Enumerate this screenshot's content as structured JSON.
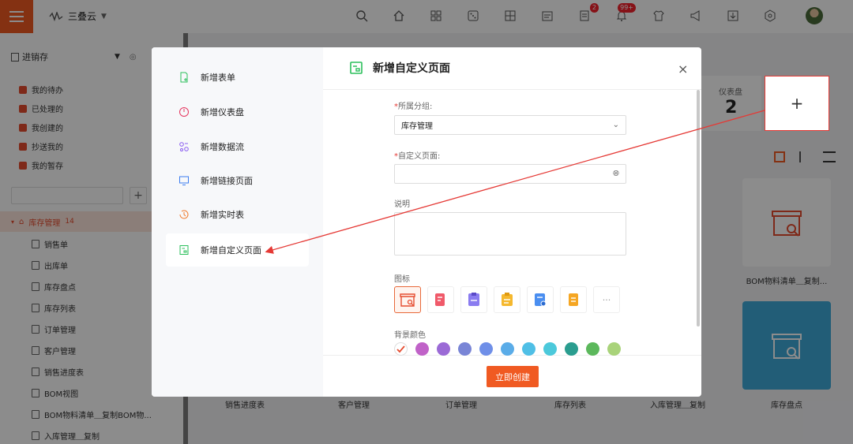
{
  "app": {
    "brand": "三叠云",
    "notifications_badge": "2",
    "messages_badge": "99+"
  },
  "sidebar": {
    "title": "进销存",
    "quick_items": [
      "我的待办",
      "已处理的",
      "我创建的",
      "抄送我的",
      "我的暂存"
    ],
    "group": {
      "label": "库存管理",
      "count": "14"
    },
    "sub_items": [
      "销售单",
      "出库单",
      "库存盘点",
      "库存列表",
      "订单管理",
      "客户管理",
      "销售进度表",
      "BOM视图",
      "BOM物料清单＿复制BOM物...",
      "入库管理＿复制"
    ]
  },
  "main": {
    "stat_label": "仪表盘",
    "stat_value": "2",
    "add_symbol": "+",
    "tile_labels_top": [
      "BOM物料清单＿复制..."
    ],
    "tile_labels_bottom": [
      "销售进度表",
      "客户管理",
      "订单管理",
      "库存列表",
      "入库管理＿复制",
      "库存盘点"
    ]
  },
  "modal": {
    "title": "新增自定义页面",
    "close": "×",
    "menu": [
      "新增表单",
      "新增仪表盘",
      "新增数据流",
      "新增链接页面",
      "新增实时表",
      "新增自定义页面"
    ],
    "menu_icons": [
      "form-add-icon",
      "dashboard-icon",
      "dataflow-icon",
      "link-page-icon",
      "realtime-icon",
      "custom-page-icon"
    ],
    "form": {
      "group_label": "所属分组:",
      "group_value": "库存管理",
      "page_label": "自定义页面:",
      "page_value": "",
      "desc_label": "说明",
      "icon_label": "图标",
      "bg_label": "背景颜色",
      "more": "···"
    },
    "swatches": [
      "#ffffff",
      "#c062c8",
      "#9b6ad6",
      "#7985d6",
      "#6f8fe8",
      "#5aace8",
      "#4fbfe6",
      "#4cc9db",
      "#2a9d8f",
      "#5cb85c",
      "#a9d37a"
    ],
    "create_button": "立即创建"
  },
  "colors": {
    "accent": "#f05a22",
    "annotation": "#e53935"
  }
}
